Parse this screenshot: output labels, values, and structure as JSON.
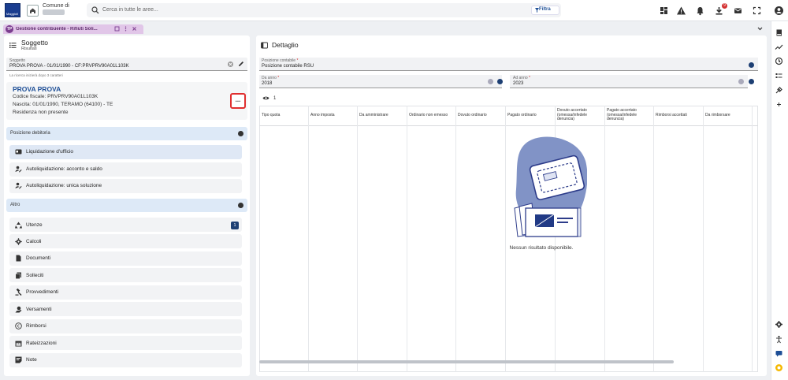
{
  "topbar": {
    "logo_text": "Maggioli",
    "comune_label": "Comune di",
    "search_placeholder": "Cerca in tutte le aree...",
    "filter_label": "Filtra",
    "notification_count": "9"
  },
  "tab": {
    "icon_text": "TP",
    "title": "Gestione contribuente - Rifiuti Soli..."
  },
  "left": {
    "title": "Soggetto",
    "subtitle": "Risultati",
    "soggetto_label": "Soggetto",
    "soggetto_value": "PROVA PROVA - 01/01/1990 - CF:PRVPRV90A01L103K",
    "hint": "La ricerca inizierà dopo 3 caratteri",
    "card": {
      "name": "PROVA PROVA",
      "codice_fiscale": "Codice fiscale: PRVPRV90A01L103K",
      "nascita": "Nascita: 01/01/1990, TERAMO (64100) - TE",
      "residenza": "Residenza non presente",
      "more": "..."
    },
    "section_posizione": "Posizione debitoria",
    "posizione_items": [
      {
        "label": "Liquidazione d'ufficio",
        "icon": "id-card-icon"
      },
      {
        "label": "Autoliquidazione: acconto e saldo",
        "icon": "user-edit-icon"
      },
      {
        "label": "Autoliquidazione: unica soluzione",
        "icon": "user-edit-icon"
      }
    ],
    "section_altro": "Altro",
    "altro_items": [
      {
        "label": "Utenze",
        "icon": "recycle-icon",
        "badge": "1"
      },
      {
        "label": "Calcoli",
        "icon": "gear-icon"
      },
      {
        "label": "Documenti",
        "icon": "document-icon"
      },
      {
        "label": "Solleciti",
        "icon": "copy-icon"
      },
      {
        "label": "Provvedimenti",
        "icon": "gavel-icon"
      },
      {
        "label": "Versamenti",
        "icon": "payment-icon"
      },
      {
        "label": "Rimborsi",
        "icon": "euro-icon"
      },
      {
        "label": "Rateizzazioni",
        "icon": "calendar-icon"
      },
      {
        "label": "Note",
        "icon": "note-icon"
      }
    ]
  },
  "right": {
    "title": "Dettaglio",
    "posizione_label": "Posizione contabile",
    "posizione_value": "Posizione contabile RSU",
    "da_anno_label": "Da anno",
    "da_anno_value": "2018",
    "ad_anno_label": "Ad anno",
    "ad_anno_value": "2023",
    "visible_columns_count": "1",
    "columns": [
      "Tipo quota",
      "Anno imposta",
      "Da amministrare",
      "Ordinario non emesso",
      "Dovuto ordinario",
      "Pagato ordinario",
      "Dovuto accertato (omessa/infedele denuncia)",
      "Pagato accertato (omessa/infedele denuncia)",
      "Rimborsi accettati",
      "Da rimborsare"
    ],
    "empty_message": "Nessun risultato disponibile."
  },
  "colors": {
    "brand": "#1d4e96",
    "tab_bg": "#e1c6e8",
    "section_bg": "#dde9f7",
    "highlight_border": "#e03030"
  }
}
